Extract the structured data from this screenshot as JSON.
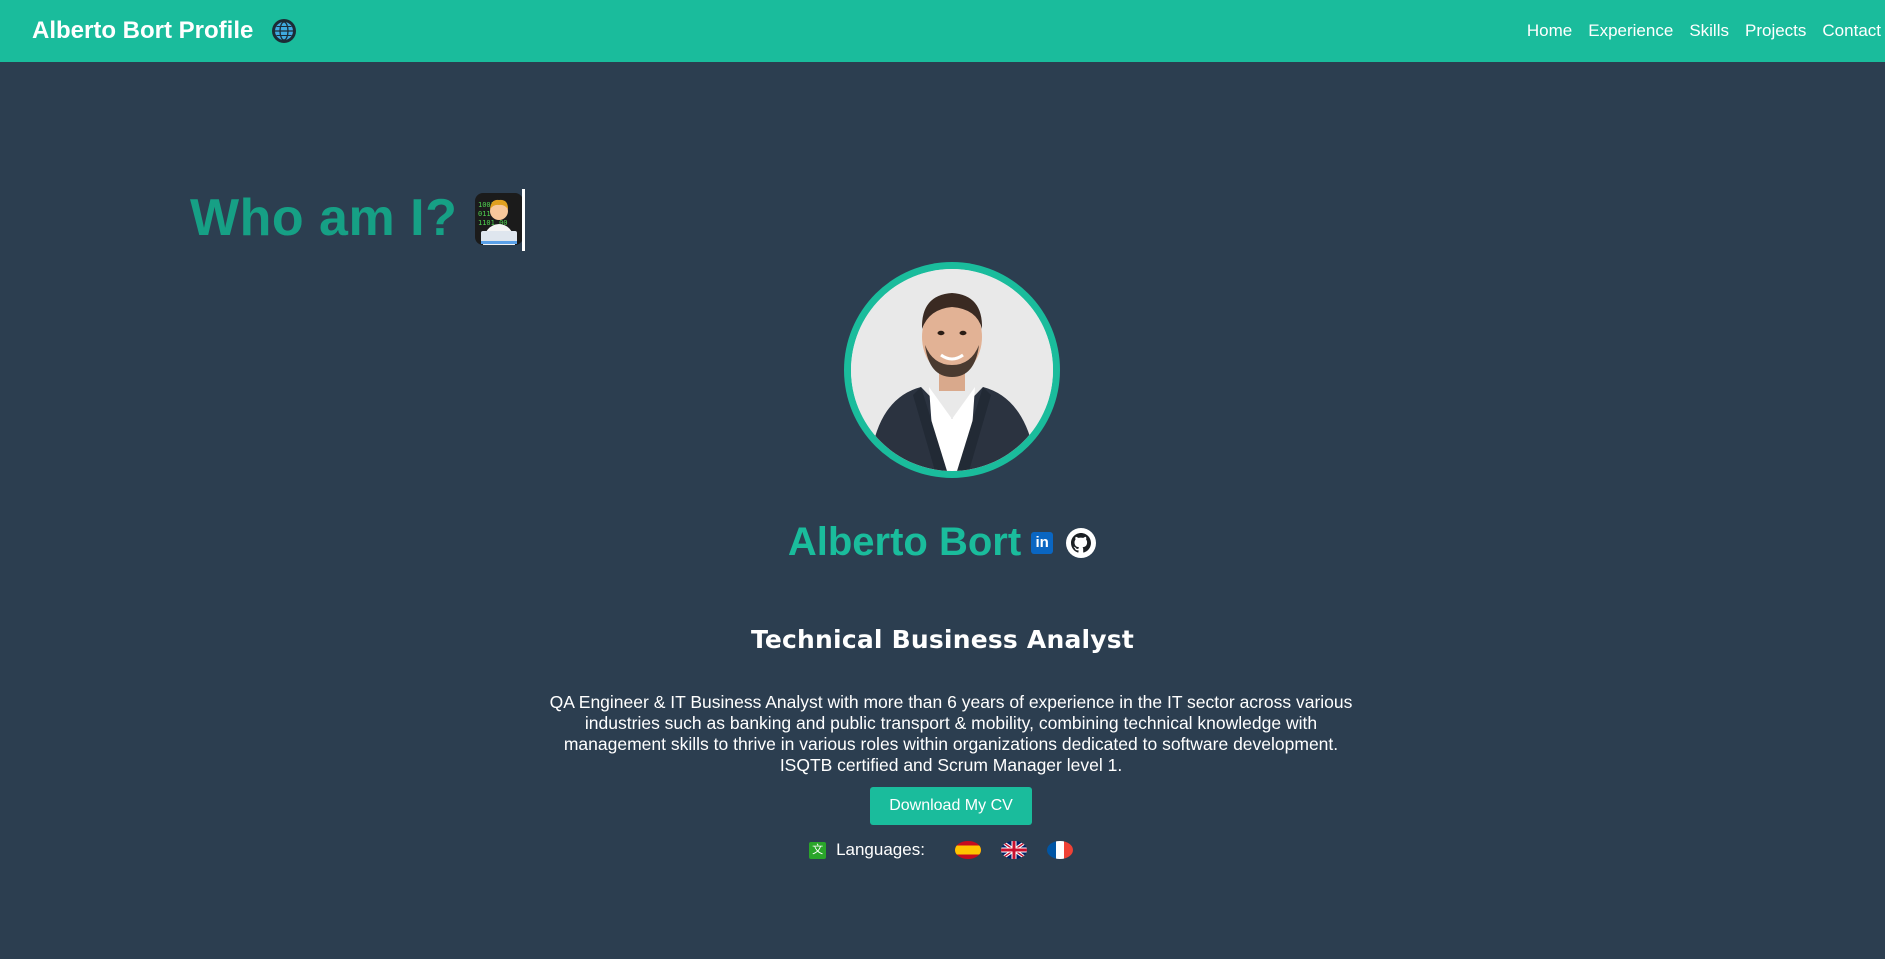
{
  "header": {
    "title": "Alberto Bort Profile",
    "icon": "globe-icon",
    "nav": [
      "Home",
      "Experience",
      "Skills",
      "Projects",
      "Contact"
    ]
  },
  "main": {
    "heading": "Who am I?",
    "heading_icon": "technologist-emoji",
    "name": "Alberto Bort",
    "social_icons": [
      "linkedin-icon",
      "github-icon"
    ],
    "role": "Technical Business Analyst",
    "bio": "QA Engineer & IT Business Analyst with more than 6 years of experience in the IT sector across various industries such as banking and public transport & mobility, combining technical knowledge with management skills to thrive in various roles within organizations dedicated to software development. ISQTB certified and Scrum Manager level 1.",
    "cv_button": "Download My CV",
    "languages_label": "Languages:",
    "languages": [
      "spanish-flag",
      "uk-flag",
      "french-flag"
    ]
  },
  "colors": {
    "navbar": "#1abc9c",
    "background": "#2c3e50",
    "heading": "#16a085",
    "accent": "#1abc9c"
  }
}
